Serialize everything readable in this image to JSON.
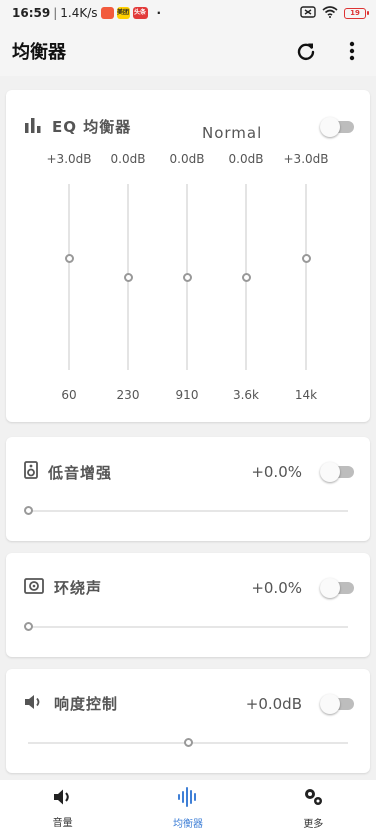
{
  "status_bar": {
    "time": "16:59",
    "separator": "|",
    "net_speed": "1.4K/s",
    "badge_1": "",
    "badge_2": "美团",
    "badge_3": "头条",
    "dot": "·",
    "battery": "19",
    "colors": {
      "battery": "#dd3333",
      "badge_1": "#f25a3c",
      "badge_2": "#ffd000",
      "badge_3": "#e23a3a"
    }
  },
  "appbar": {
    "title": "均衡器",
    "refresh_icon": "refresh-icon",
    "more_icon": "more-vert-icon"
  },
  "eq": {
    "title": "EQ 均衡器",
    "preset": "Normal",
    "enabled": false,
    "bands": [
      {
        "gain": "+3.0dB",
        "freq": "60",
        "level": 0.6
      },
      {
        "gain": "0.0dB",
        "freq": "230",
        "level": 0.5
      },
      {
        "gain": "0.0dB",
        "freq": "910",
        "level": 0.5
      },
      {
        "gain": "0.0dB",
        "freq": "3.6k",
        "level": 0.5
      },
      {
        "gain": "+3.0dB",
        "freq": "14k",
        "level": 0.6
      }
    ]
  },
  "bass": {
    "title": "低音增强",
    "value": "+0.0%",
    "enabled": false,
    "level": 0.0
  },
  "surround": {
    "title": "环绕声",
    "value": "+0.0%",
    "enabled": false,
    "level": 0.0
  },
  "loudness": {
    "title": "响度控制",
    "value": "+0.0dB",
    "enabled": false,
    "level": 0.5
  },
  "bottom_nav": {
    "items": [
      {
        "label": "音量",
        "icon": "volume-icon",
        "active": false
      },
      {
        "label": "均衡器",
        "icon": "equalizer-wave-icon",
        "active": true
      },
      {
        "label": "更多",
        "icon": "more-settings-icon",
        "active": false
      }
    ],
    "active_color": "#3f7fd6"
  }
}
